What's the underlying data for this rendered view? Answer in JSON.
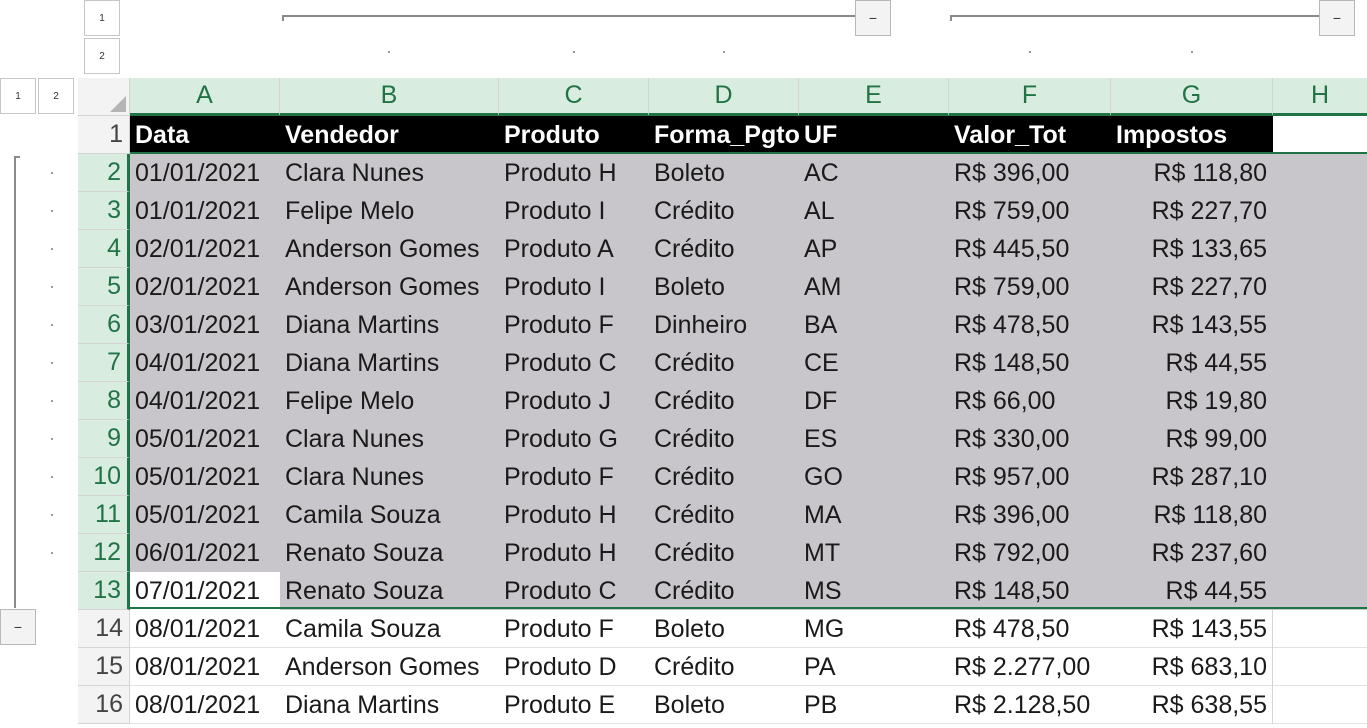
{
  "outline": {
    "col_level_buttons": [
      "1",
      "2"
    ],
    "row_level_buttons": [
      "1",
      "2"
    ],
    "collapse_symbol": "−"
  },
  "columns": [
    "A",
    "B",
    "C",
    "D",
    "E",
    "F",
    "G",
    "H"
  ],
  "headers": [
    "Data",
    "Vendedor",
    "Produto",
    "Forma_Pgto",
    "UF",
    "Valor_Tot",
    "Impostos"
  ],
  "rows": [
    {
      "num": "2",
      "cells": [
        "01/01/2021",
        "Clara Nunes",
        "Produto H",
        "Boleto",
        "AC",
        "R$ 396,00",
        "R$ 118,80"
      ]
    },
    {
      "num": "3",
      "cells": [
        "01/01/2021",
        "Felipe Melo",
        "Produto I",
        "Crédito",
        "AL",
        "R$ 759,00",
        "R$ 227,70"
      ]
    },
    {
      "num": "4",
      "cells": [
        "02/01/2021",
        "Anderson Gomes",
        "Produto A",
        "Crédito",
        "AP",
        "R$ 445,50",
        "R$ 133,65"
      ]
    },
    {
      "num": "5",
      "cells": [
        "02/01/2021",
        "Anderson Gomes",
        "Produto I",
        "Boleto",
        "AM",
        "R$ 759,00",
        "R$ 227,70"
      ]
    },
    {
      "num": "6",
      "cells": [
        "03/01/2021",
        "Diana Martins",
        "Produto F",
        "Dinheiro",
        "BA",
        "R$ 478,50",
        "R$ 143,55"
      ]
    },
    {
      "num": "7",
      "cells": [
        "04/01/2021",
        "Diana Martins",
        "Produto C",
        "Crédito",
        "CE",
        "R$ 148,50",
        "R$ 44,55"
      ]
    },
    {
      "num": "8",
      "cells": [
        "04/01/2021",
        "Felipe Melo",
        "Produto J",
        "Crédito",
        "DF",
        "R$ 66,00",
        "R$ 19,80"
      ]
    },
    {
      "num": "9",
      "cells": [
        "05/01/2021",
        "Clara Nunes",
        "Produto G",
        "Crédito",
        "ES",
        "R$ 330,00",
        "R$ 99,00"
      ]
    },
    {
      "num": "10",
      "cells": [
        "05/01/2021",
        "Clara Nunes",
        "Produto F",
        "Crédito",
        "GO",
        "R$ 957,00",
        "R$ 287,10"
      ]
    },
    {
      "num": "11",
      "cells": [
        "05/01/2021",
        "Camila Souza",
        "Produto H",
        "Crédito",
        "MA",
        "R$ 396,00",
        "R$ 118,80"
      ]
    },
    {
      "num": "12",
      "cells": [
        "06/01/2021",
        "Renato Souza",
        "Produto H",
        "Crédito",
        "MT",
        "R$ 792,00",
        "R$ 237,60"
      ]
    },
    {
      "num": "13",
      "cells": [
        "07/01/2021",
        "Renato Souza",
        "Produto C",
        "Crédito",
        "MS",
        "R$ 148,50",
        "R$ 44,55"
      ]
    },
    {
      "num": "14",
      "cells": [
        "08/01/2021",
        "Camila Souza",
        "Produto F",
        "Boleto",
        "MG",
        "R$ 478,50",
        "R$ 143,55"
      ]
    },
    {
      "num": "15",
      "cells": [
        "08/01/2021",
        "Anderson Gomes",
        "Produto D",
        "Crédito",
        "PA",
        "R$ 2.277,00",
        "R$ 683,10"
      ]
    },
    {
      "num": "16",
      "cells": [
        "08/01/2021",
        "Diana Martins",
        "Produto E",
        "Boleto",
        "PB",
        "R$ 2.128,50",
        "R$ 638,55"
      ]
    }
  ],
  "header_row_num": "1",
  "selection": {
    "first_row": "2",
    "last_row": "13",
    "active_cell": "A13"
  },
  "colors": {
    "accent": "#217346",
    "selection": "#c8c6ca",
    "header_fill": "#000000"
  }
}
